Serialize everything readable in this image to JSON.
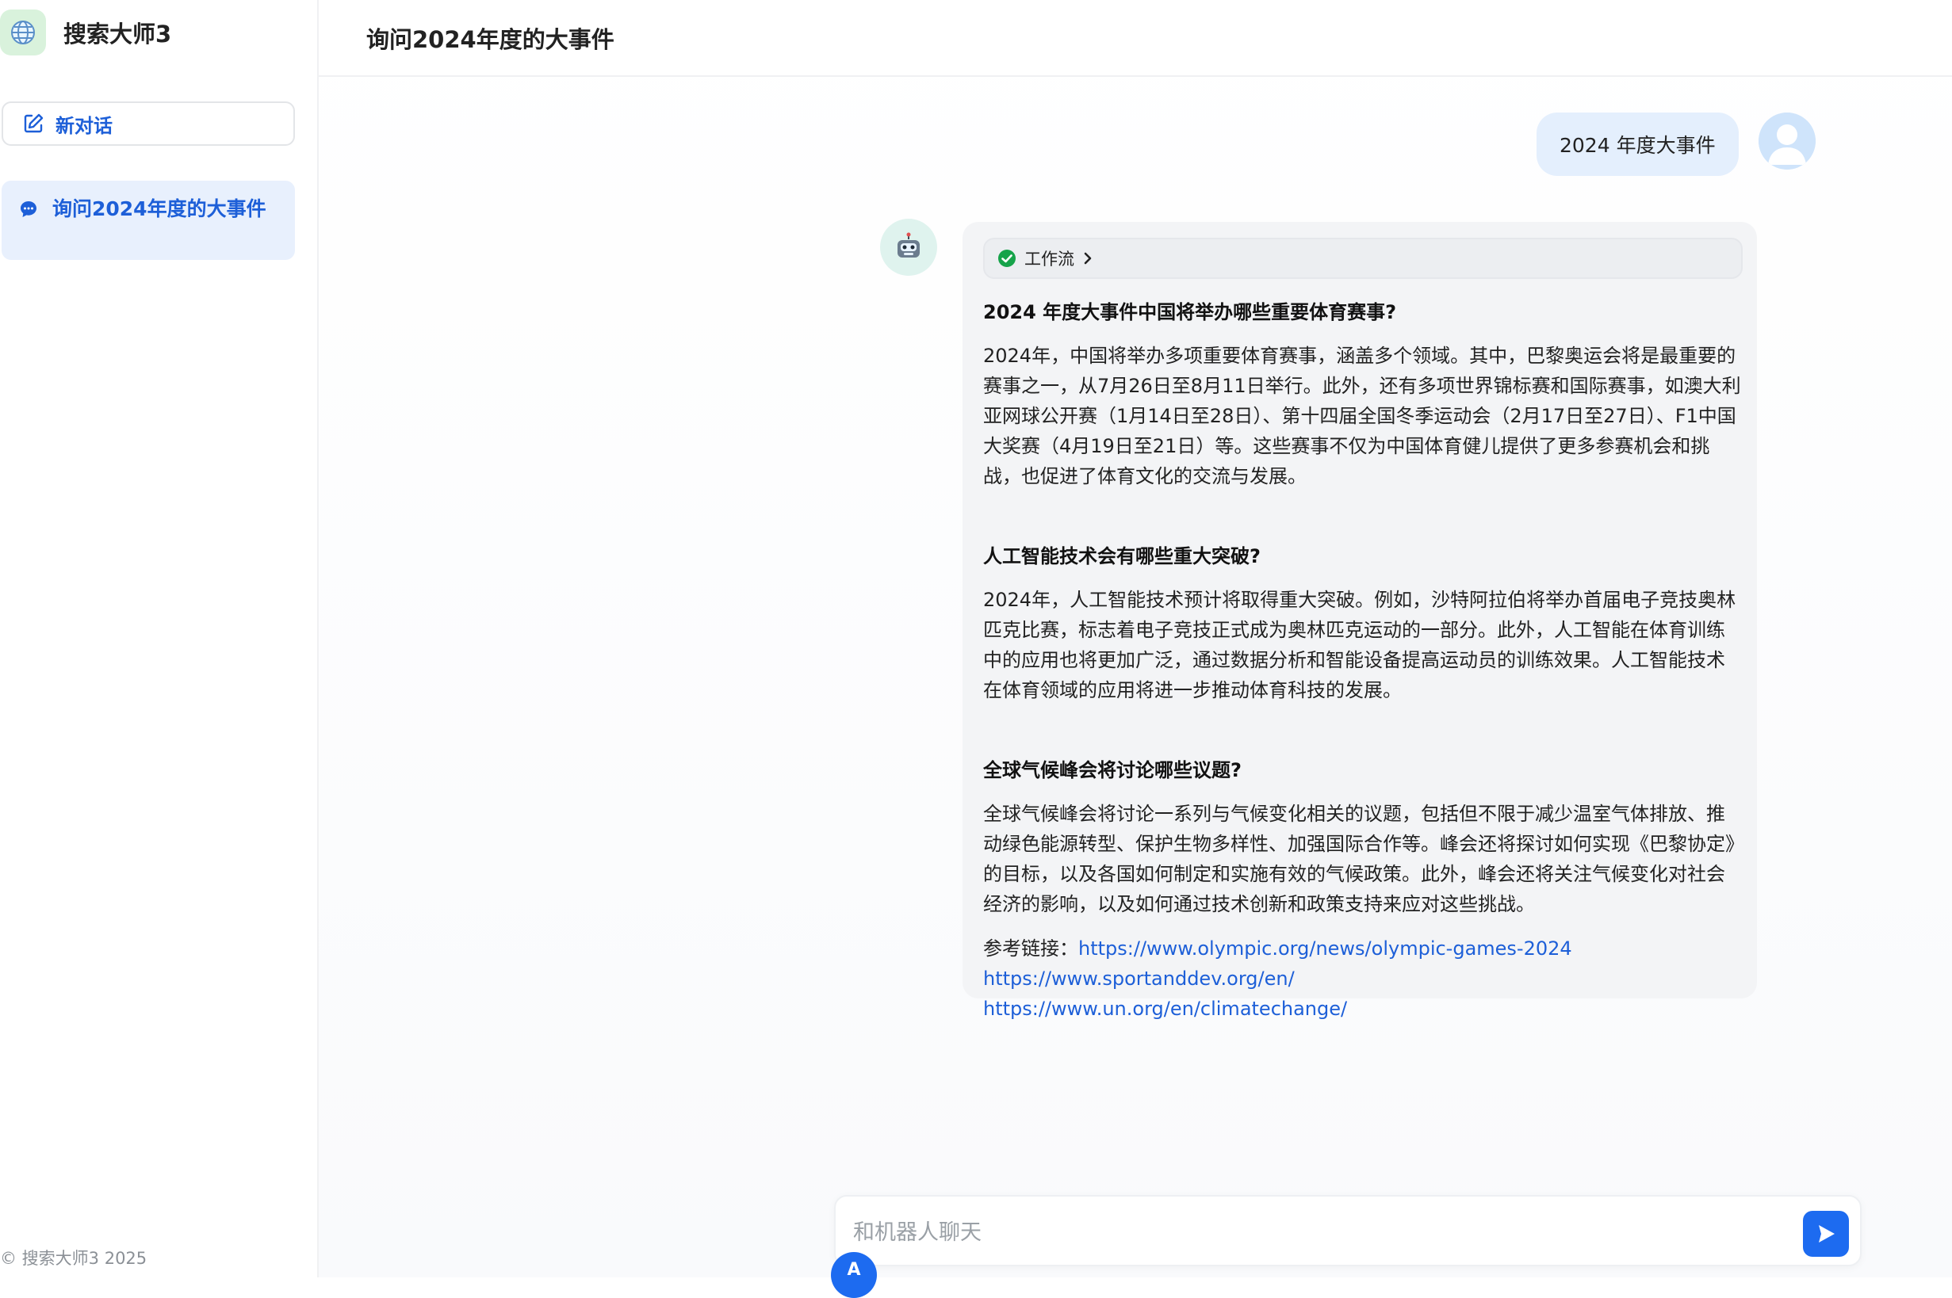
{
  "sidebar": {
    "brand_title": "搜索大师3",
    "new_chat_label": "新对话",
    "conversations": [
      {
        "label": "询问2024年度的大事件",
        "active": true
      }
    ],
    "footer": "© 搜索大师3 2025"
  },
  "header": {
    "title": "询问2024年度的大事件"
  },
  "messages": {
    "user": {
      "text": "2024 年度大事件"
    },
    "assistant": {
      "workflow_label": "工作流",
      "sections": [
        {
          "heading": "2024 年度大事件中国将举办哪些重要体育赛事?",
          "body": "2024年，中国将举办多项重要体育赛事，涵盖多个领域。其中，巴黎奥运会将是最重要的赛事之一，从7月26日至8月11日举行。此外，还有多项世界锦标赛和国际赛事，如澳大利亚网球公开赛（1月14日至28日）、第十四届全国冬季运动会（2月17日至27日）、F1中国大奖赛（4月19日至21日）等。这些赛事不仅为中国体育健儿提供了更多参赛机会和挑战，也促进了体育文化的交流与发展。"
        },
        {
          "heading": "人工智能技术会有哪些重大突破?",
          "body": "2024年，人工智能技术预计将取得重大突破。例如，沙特阿拉伯将举办首届电子竞技奥林匹克比赛，标志着电子竞技正式成为奥林匹克运动的一部分。此外，人工智能在体育训练中的应用也将更加广泛，通过数据分析和智能设备提高运动员的训练效果。人工智能技术在体育领域的应用将进一步推动体育科技的发展。"
        },
        {
          "heading": "全球气候峰会将讨论哪些议题?",
          "body": "全球气候峰会将讨论一系列与气候变化相关的议题，包括但不限于减少温室气体排放、推动绿色能源转型、保护生物多样性、加强国际合作等。峰会还将探讨如何实现《巴黎协定》的目标，以及各国如何制定和实施有效的气候政策。此外，峰会还将关注气候变化对社会经济的影响，以及如何通过技术创新和政策支持来应对这些挑战。"
        }
      ],
      "refs_label": "参考链接：",
      "refs": [
        "https://www.olympic.org/news/olympic-games-2024",
        "https://www.sportanddev.org/en/",
        "https://www.un.org/en/climatechange/"
      ]
    }
  },
  "composer": {
    "placeholder": "和机器人聊天",
    "value": "",
    "badge": "A"
  },
  "colors": {
    "accent": "#1d6bf0",
    "link": "#1d5fd8",
    "active_item_bg": "#e8f0fd",
    "user_bubble_bg": "#e4effd",
    "answer_bg": "#f3f4f6",
    "success": "#16a34a"
  },
  "icons": {
    "brand": "globe-icon",
    "new_chat": "edit-icon",
    "conversation": "chat-bubble-icon",
    "workflow_status": "check-circle-icon",
    "workflow_expand": "chevron-right-icon",
    "user": "user-avatar-icon",
    "assistant": "robot-icon",
    "send": "send-icon"
  }
}
